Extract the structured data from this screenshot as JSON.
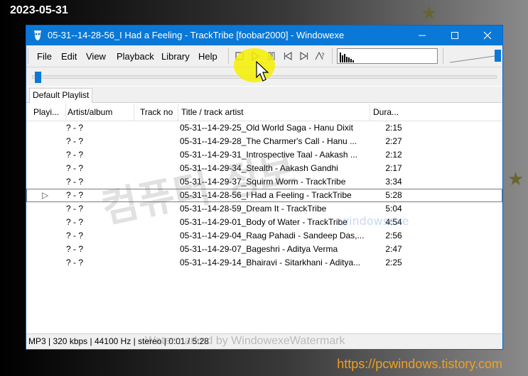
{
  "screen": {
    "date_stamp": "2023-05-31",
    "url_stamp": "https://pcwindows.tistory.com",
    "watermark_text": "Watermarked by WindowexeWatermark",
    "watermark_text_2": "windowsexe",
    "watermark_korean": "컴퓨터 정보"
  },
  "window": {
    "title": "05-31--14-28-56_I Had a Feeling - TrackTribe  [foobar2000]   - Windowexe",
    "accent_color": "#0a78d7"
  },
  "menu": {
    "items": [
      "File",
      "Edit",
      "View",
      "Playback",
      "Library",
      "Help"
    ]
  },
  "toolbar": {
    "icons": [
      "stop-icon",
      "play-icon",
      "pause-icon",
      "previous-icon",
      "next-icon",
      "random-icon"
    ]
  },
  "playback": {
    "seek_fraction": 0.002,
    "volume_fraction": 1.0
  },
  "playlist": {
    "tab_label": "Default Playlist",
    "columns": [
      "Playi...",
      "Artist/album",
      "Track no",
      "Title / track artist",
      "Dura..."
    ],
    "rows": [
      {
        "playing": "",
        "artist": "? - ?",
        "track": "",
        "title": "05-31--14-29-25_Old World Saga - Hanu Dixit",
        "duration": "2:15"
      },
      {
        "playing": "",
        "artist": "? - ?",
        "track": "",
        "title": "05-31--14-29-28_The Charmer's Call - Hanu ...",
        "duration": "2:27"
      },
      {
        "playing": "",
        "artist": "? - ?",
        "track": "",
        "title": "05-31--14-29-31_Introspective Taal - Aakash ...",
        "duration": "2:12"
      },
      {
        "playing": "",
        "artist": "? - ?",
        "track": "",
        "title": "05-31--14-29-34_Stealth - Aakash Gandhi",
        "duration": "2:17"
      },
      {
        "playing": "",
        "artist": "? - ?",
        "track": "",
        "title": "05-31--14-29-37_Squirm Worm - TrackTribe",
        "duration": "3:34"
      },
      {
        "playing": "▷",
        "artist": "? - ?",
        "track": "",
        "title": "05-31--14-28-56_I Had a Feeling - TrackTribe",
        "duration": "5:28"
      },
      {
        "playing": "",
        "artist": "? - ?",
        "track": "",
        "title": "05-31--14-28-59_Dream It - TrackTribe",
        "duration": "5:04"
      },
      {
        "playing": "",
        "artist": "? - ?",
        "track": "",
        "title": "05-31--14-29-01_Body of Water - TrackTribe",
        "duration": "4:54"
      },
      {
        "playing": "",
        "artist": "? - ?",
        "track": "",
        "title": "05-31--14-29-04_Raag Pahadi - Sandeep Das,...",
        "duration": "2:56"
      },
      {
        "playing": "",
        "artist": "? - ?",
        "track": "",
        "title": "05-31--14-29-07_Bageshri - Aditya Verma",
        "duration": "2:47"
      },
      {
        "playing": "",
        "artist": "? - ?",
        "track": "",
        "title": "05-31--14-29-14_Bhairavi - Sitarkhani - Aditya...",
        "duration": "2:25"
      }
    ]
  },
  "status": {
    "text": "MP3 | 320 kbps | 44100 Hz | stereo | 0:01 / 5:28"
  }
}
